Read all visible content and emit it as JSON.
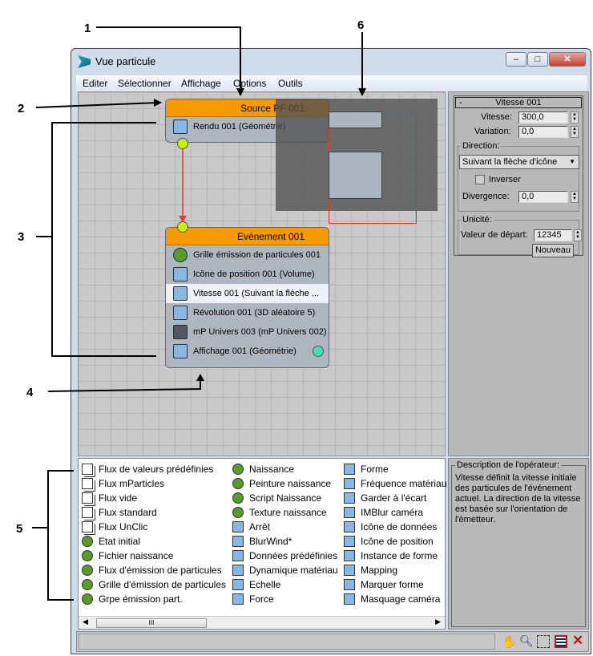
{
  "window": {
    "title": "Vue particule",
    "controls": [
      "minimize",
      "maximize",
      "close"
    ]
  },
  "menu": [
    "Editer",
    "Sélectionner",
    "Affichage",
    "Options",
    "Outils"
  ],
  "source_node": {
    "title": "Source PF 001",
    "rows": [
      {
        "label": "Rendu 001 (Géométrie)",
        "icon": "teapot-icon"
      }
    ],
    "header_color": "#f79a00"
  },
  "event_node": {
    "title": "Evénement 001",
    "rows": [
      {
        "label": "Grille émission de particules 001",
        "icon": "grid-birth-icon"
      },
      {
        "label": "Icône de position 001 (Volume)",
        "icon": "position-icon"
      },
      {
        "label": "Vitesse 001 (Suivant la flèche ...",
        "icon": "speed-icon",
        "selected": true
      },
      {
        "label": "Révolution 001 (3D aléatoire 5)",
        "icon": "rotation-icon"
      },
      {
        "label": "mP Univers 003 (mP Univers 002)",
        "icon": "mp-world-icon"
      },
      {
        "label": "Affichage 001 (Géométrie)",
        "icon": "display-icon"
      }
    ]
  },
  "params": {
    "rollout": "Vitesse 001",
    "collapse": "-",
    "speed_label": "Vitesse:",
    "speed": "300,0",
    "variation_label": "Variation:",
    "variation": "0,0",
    "direction_group": "Direction:",
    "direction": "Suivant la flèche d'icône",
    "reverse_label": "Inverser",
    "reverse": false,
    "divergence_label": "Divergence:",
    "divergence": "0,0",
    "uniqueness_group": "Unicité:",
    "seed_label": "Valeur de départ:",
    "seed": "12345",
    "new_button": "Nouveau"
  },
  "depot": {
    "columns": [
      [
        "Flux de valeurs prédéfinies",
        "Flux mParticles",
        "Flux vide",
        "Flux standard",
        "Flux UnClic",
        "Etat initial",
        "Fichier naissance",
        "Flux d'émission de particules",
        "Grille d'émission de particules",
        "Grpe émission part."
      ],
      [
        "Naissance",
        "Peinture naissance",
        "Script Naissance",
        "Texture naissance",
        "Arrêt",
        "BlurWind*",
        "Données prédéfinies",
        "Dynamique matériau",
        "Echelle",
        "Force"
      ],
      [
        "Forme",
        "Fréquence matériau",
        "Garder à l'écart",
        "IMBlur caméra",
        "Icône de données",
        "Icône de position",
        "Instance de forme",
        "Mapping",
        "Marquer forme",
        "Masquage caméra"
      ]
    ],
    "scroll_thumb": "III"
  },
  "description": {
    "title": "Description de l'opérateur:",
    "text": "Vitesse définit la vitesse initiale des particules de l'événement actuel. La direction de la vitesse est basée sur l'orientation de l'émetteur."
  },
  "status_tools": [
    "pan-icon",
    "zoom-icon",
    "zoom-region-icon",
    "zoom-extents-icon",
    "no-zoom-icon"
  ],
  "callouts": [
    "1",
    "2",
    "3",
    "4",
    "5",
    "6"
  ]
}
